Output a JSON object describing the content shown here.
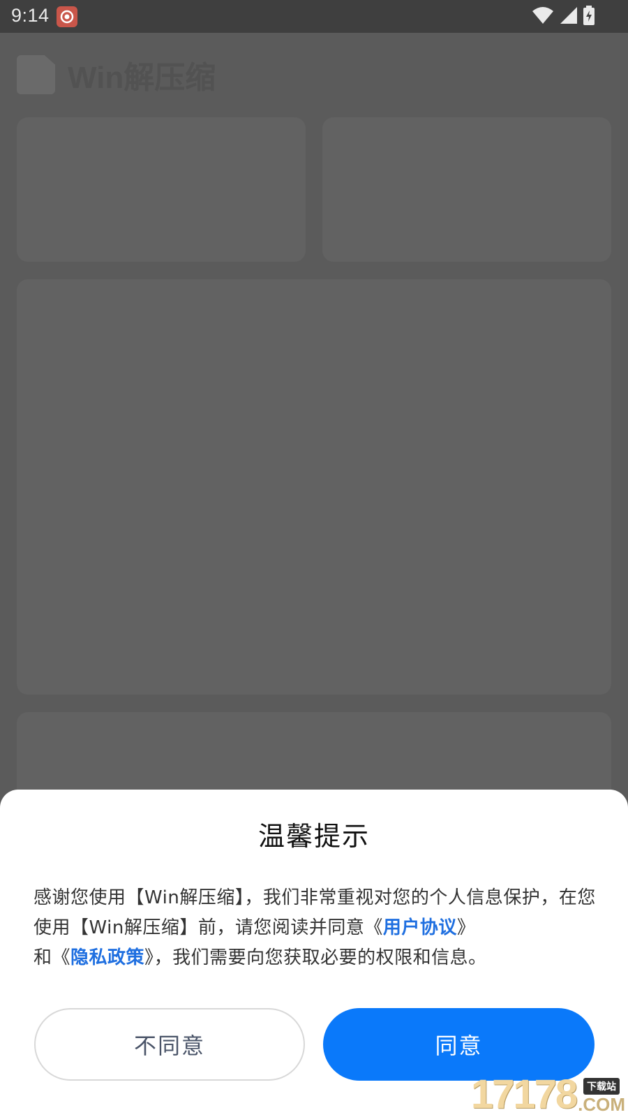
{
  "status_bar": {
    "time": "9:14",
    "icons": [
      "notification-app-icon",
      "wifi-icon",
      "signal-icon",
      "battery-charging-icon"
    ]
  },
  "background_app": {
    "title": "Win解压缩",
    "logo_icon": "document-icon"
  },
  "dialog": {
    "title": "温馨提示",
    "body": {
      "part1": "感谢您使用【Win解压缩】，我们非常重视对您的个人信息保护，在您使用【Win解压缩】前，请您阅读并同意",
      "link1_prefix": "《",
      "link1": "用户协议",
      "link1_suffix": "》",
      "middle": "和",
      "link2_prefix": "《",
      "link2": "隐私政策",
      "link2_suffix": "》",
      "part2": "，我们需要向您获取必要的权限和信息。"
    },
    "disagree_label": "不同意",
    "agree_label": "同意"
  },
  "watermark": {
    "number": "17178",
    "tag": "下载站",
    "suffix": ".COM"
  },
  "colors": {
    "accent": "#0a79fa",
    "link": "#1f6fe0",
    "overlay": "#5b5b5b"
  }
}
